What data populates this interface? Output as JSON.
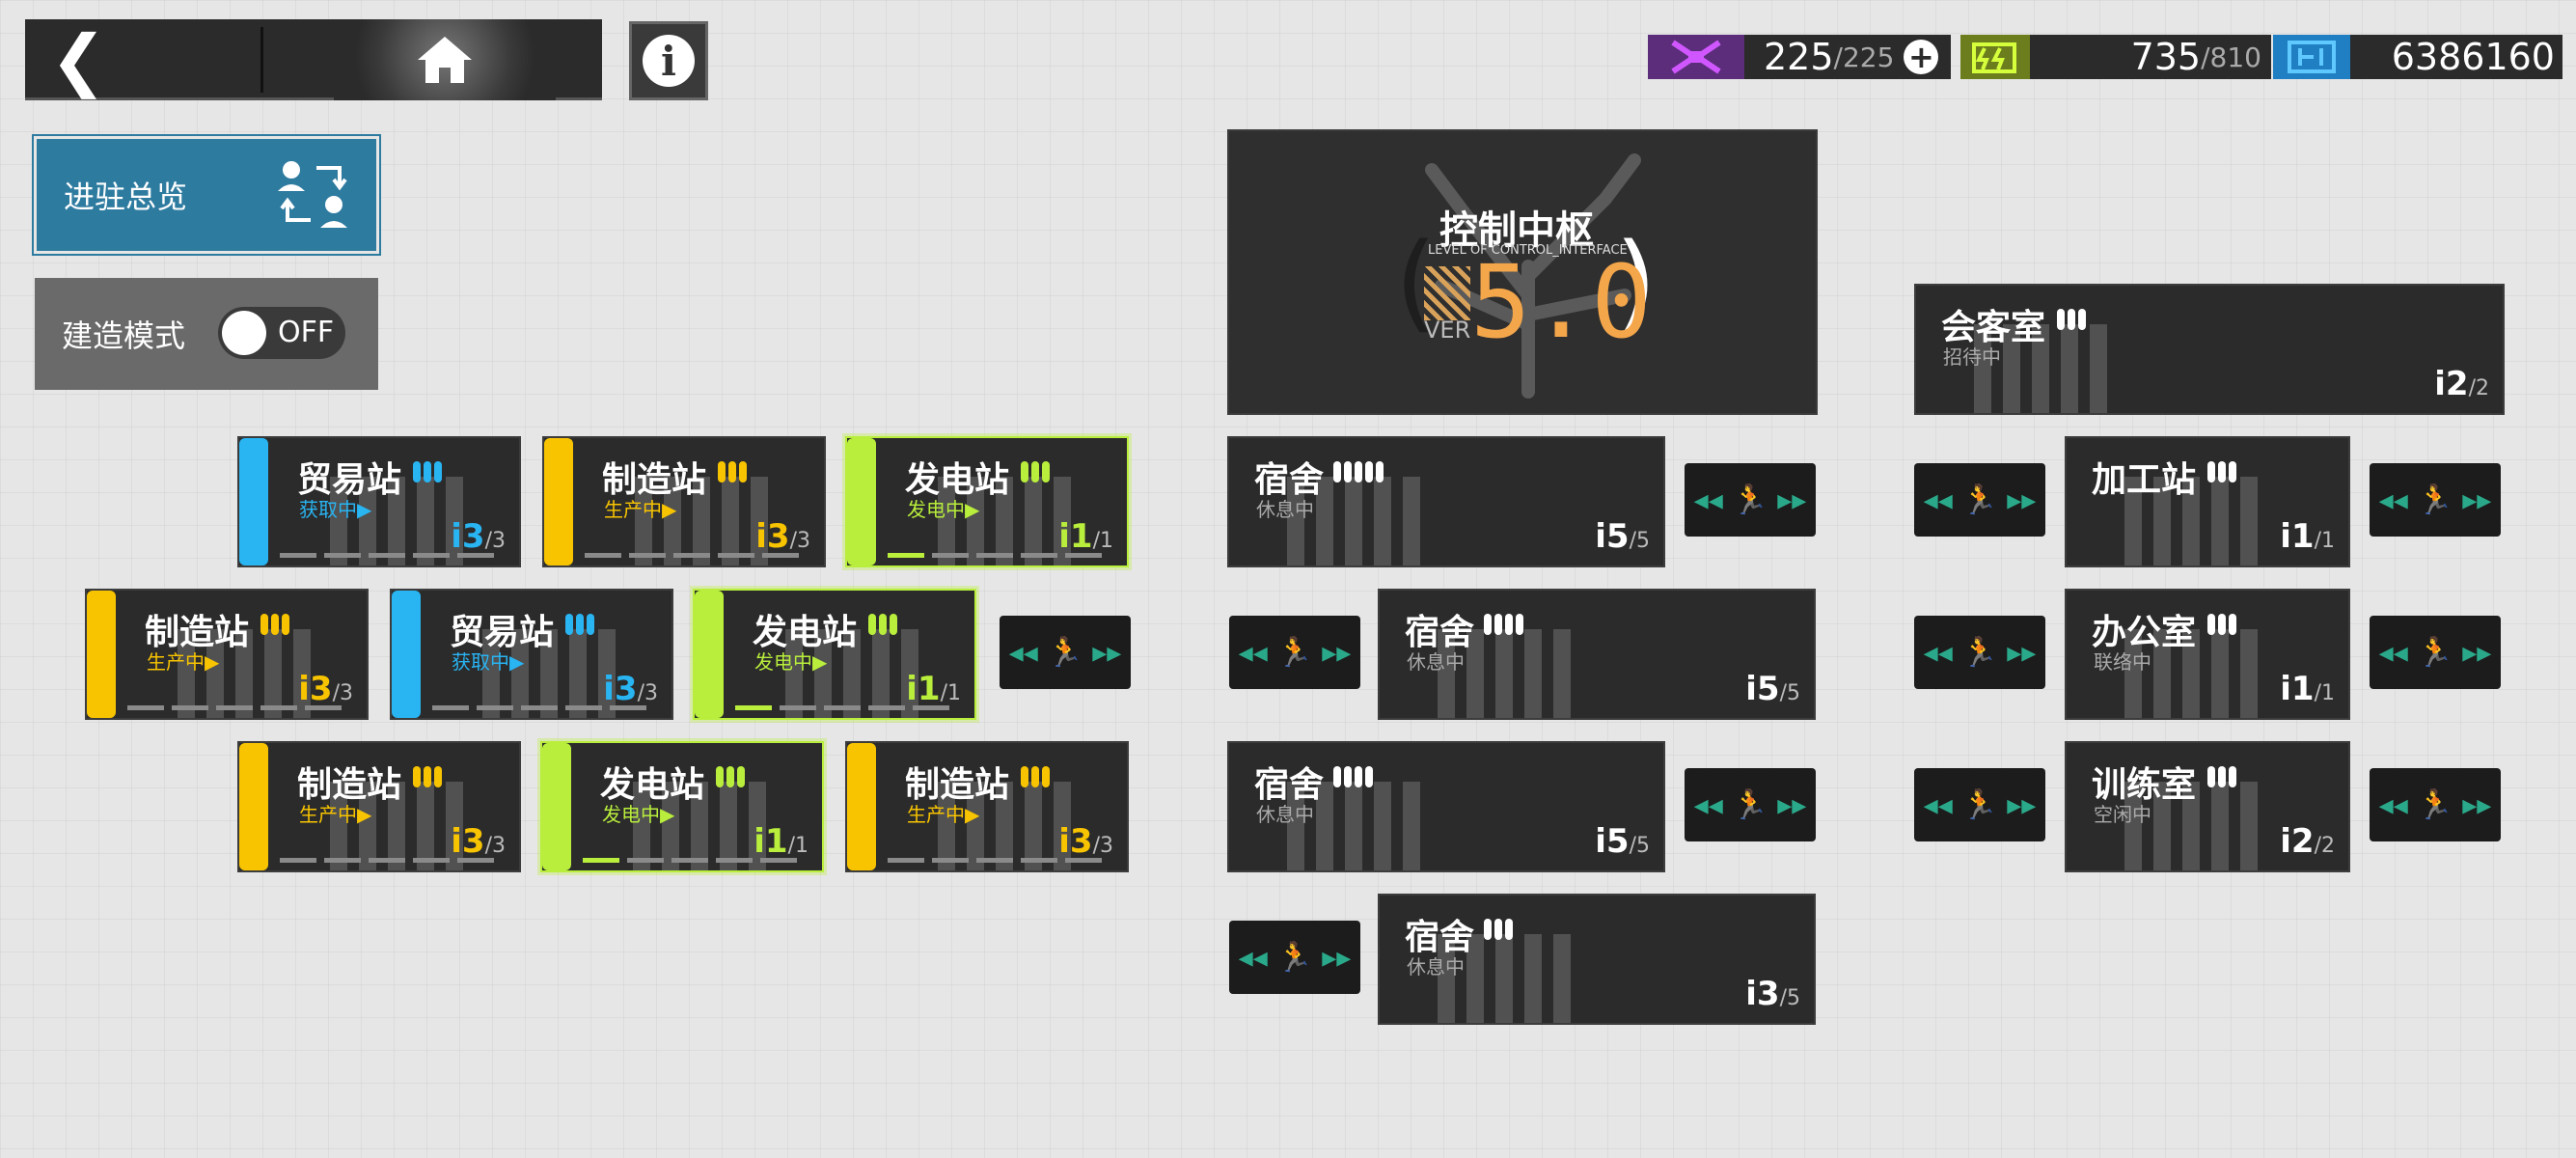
{
  "resources": {
    "sanity": {
      "value": "225",
      "max": "/225",
      "plus": "+"
    },
    "drones": {
      "value": "735",
      "max": "/810"
    },
    "lmd": {
      "value": "6386160"
    }
  },
  "left_panel": {
    "overview_label": "进驻总览",
    "build_label": "建造模式",
    "toggle_label": "OFF"
  },
  "control_center": {
    "name": "控制中枢",
    "sub": "LEVEL OF CONTROL_INTERFACE",
    "ver_label": "VER",
    "level": "5.0"
  },
  "colors": {
    "trade": "#29b4f2",
    "factory": "#f8c400",
    "power": "#b9ee3c",
    "dorm": "#ffffff",
    "panel_bg": "#2b2b2b"
  },
  "rooms": [
    {
      "id": "trade1",
      "name": "贸易站",
      "status": "获取中▶",
      "count": "3",
      "max": "/3",
      "kind": "trade",
      "pips": 3
    },
    {
      "id": "fac1",
      "name": "制造站",
      "status": "生产中▶",
      "count": "3",
      "max": "/3",
      "kind": "factory",
      "pips": 3
    },
    {
      "id": "pow1",
      "name": "发电站",
      "status": "发电中▶",
      "count": "1",
      "max": "/1",
      "kind": "power",
      "pips": 3
    },
    {
      "id": "fac2",
      "name": "制造站",
      "status": "生产中▶",
      "count": "3",
      "max": "/3",
      "kind": "factory",
      "pips": 3
    },
    {
      "id": "trade2",
      "name": "贸易站",
      "status": "获取中▶",
      "count": "3",
      "max": "/3",
      "kind": "trade",
      "pips": 3
    },
    {
      "id": "pow2",
      "name": "发电站",
      "status": "发电中▶",
      "count": "1",
      "max": "/1",
      "kind": "power",
      "pips": 3
    },
    {
      "id": "fac3",
      "name": "制造站",
      "status": "生产中▶",
      "count": "3",
      "max": "/3",
      "kind": "factory",
      "pips": 3
    },
    {
      "id": "pow3",
      "name": "发电站",
      "status": "发电中▶",
      "count": "1",
      "max": "/1",
      "kind": "power",
      "pips": 3
    },
    {
      "id": "fac4",
      "name": "制造站",
      "status": "生产中▶",
      "count": "3",
      "max": "/3",
      "kind": "factory",
      "pips": 3
    },
    {
      "id": "dorm1",
      "name": "宿舍",
      "status": "休息中",
      "count": "5",
      "max": "/5",
      "kind": "dorm",
      "pips": 5
    },
    {
      "id": "dorm2",
      "name": "宿舍",
      "status": "休息中",
      "count": "5",
      "max": "/5",
      "kind": "dorm",
      "pips": 4
    },
    {
      "id": "dorm3",
      "name": "宿舍",
      "status": "休息中",
      "count": "5",
      "max": "/5",
      "kind": "dorm",
      "pips": 4
    },
    {
      "id": "dorm4",
      "name": "宿舍",
      "status": "休息中",
      "count": "3",
      "max": "/5",
      "kind": "dorm",
      "pips": 3
    },
    {
      "id": "reception",
      "name": "会客室",
      "status": "招待中",
      "count": "2",
      "max": "/2",
      "kind": "dorm",
      "pips": 3
    },
    {
      "id": "workshop",
      "name": "加工站",
      "status": "",
      "count": "1",
      "max": "/1",
      "kind": "dorm",
      "pips": 3
    },
    {
      "id": "office",
      "name": "办公室",
      "status": "联络中",
      "count": "1",
      "max": "/1",
      "kind": "dorm",
      "pips": 3
    },
    {
      "id": "training",
      "name": "训练室",
      "status": "空闲中",
      "count": "2",
      "max": "/2",
      "kind": "dorm",
      "pips": 3
    }
  ]
}
